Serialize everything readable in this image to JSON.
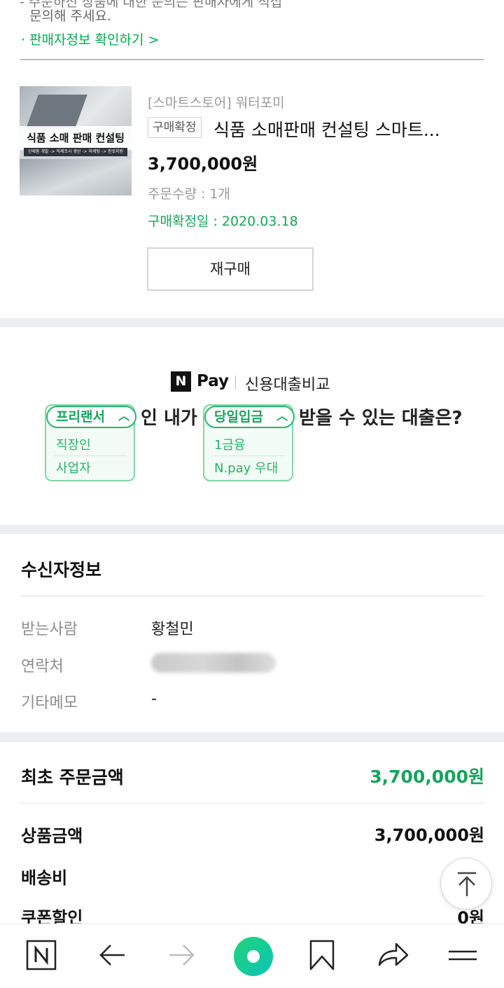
{
  "notice": {
    "cut_line": "- 주문하신 상품에 대한 문의는 판매자에게 직접",
    "line": "문의해 주세요.",
    "seller_link": "· 판매자정보 확인하기 >"
  },
  "order_item": {
    "store": "[스마트스토어] 워터포미",
    "status_tag": "구매확정",
    "title": "식품 소매판매 컨설팅 스마트...",
    "price": "3,700,000원",
    "quantity": "주문수량 : 1개",
    "confirm_date": "구매확정일 : 2020.03.18",
    "rebuy_label": "재구매",
    "thumbnail": {
      "banner": "식품 소매 판매 컨설팅",
      "strip": "신제품 개발 -> 직제조시 생산 -> 마케팅 -> 판로지원"
    }
  },
  "ad": {
    "logo_n": "N",
    "logo_pay": "Pay",
    "subtitle": "신용대출비교",
    "dropdown1": {
      "selected": "프리랜서",
      "options": [
        "직장인",
        "사업자"
      ]
    },
    "text1": "인 내가",
    "dropdown2": {
      "selected": "당일입금",
      "options": [
        "1금융",
        "N.pay 우대"
      ]
    },
    "text2": "받을 수 있는 대출은?"
  },
  "recipient": {
    "title": "수신자정보",
    "rows": [
      {
        "label": "받는사람",
        "value": "황철민"
      },
      {
        "label": "연락처",
        "value": ""
      },
      {
        "label": "기타메모",
        "value": "-"
      }
    ]
  },
  "amount": {
    "title": "최초 주문금액",
    "total": "3,700,000원",
    "rows": [
      {
        "label": "상품금액",
        "value": "3,700,000원"
      },
      {
        "label": "배송비",
        "value": ""
      },
      {
        "label": "쿠폰할인",
        "value": "0원"
      }
    ]
  },
  "colors": {
    "accent": "#03c75a",
    "link_green": "#03a94d",
    "confirm_green": "#1aa35a"
  },
  "bottom_bar": {
    "icons": [
      "naver-home-icon",
      "back-arrow-icon",
      "forward-arrow-icon",
      "green-dot-icon",
      "bookmark-icon",
      "share-icon",
      "menu-icon"
    ]
  }
}
